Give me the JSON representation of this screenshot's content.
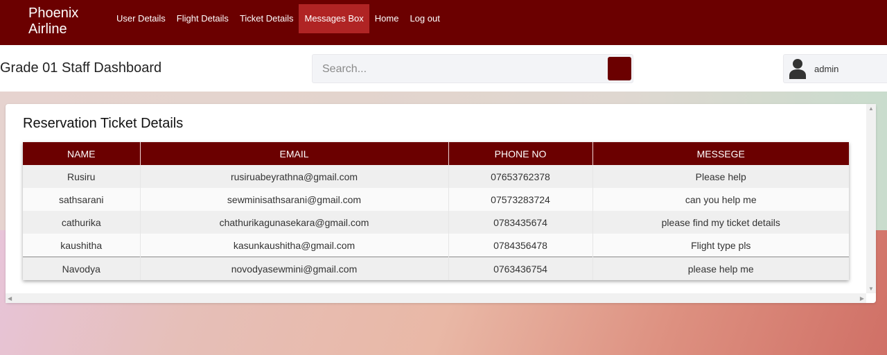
{
  "brand": {
    "line1": "Phoenix",
    "line2": "Airline"
  },
  "nav": {
    "items": [
      {
        "label": "User Details"
      },
      {
        "label": "Flight Details"
      },
      {
        "label": "Ticket Details"
      },
      {
        "label": "Messages Box",
        "active": true
      },
      {
        "label": "Home"
      },
      {
        "label": "Log out"
      }
    ]
  },
  "header": {
    "title": "Grade 01 Staff Dashboard",
    "search_placeholder": "Search...",
    "user": "admin"
  },
  "card": {
    "title": "Reservation Ticket Details",
    "columns": [
      "NAME",
      "EMAIL",
      "PHONE NO",
      "MESSEGE"
    ],
    "rows": [
      {
        "name": "Rusiru",
        "email": "rusiruabeyrathna@gmail.com",
        "phone": "07653762378",
        "message": "Please help"
      },
      {
        "name": "sathsarani",
        "email": "sewminisathsarani@gmail.com",
        "phone": "07573283724",
        "message": "can you help me"
      },
      {
        "name": "cathurika",
        "email": "chathurikagunasekara@gmail.com",
        "phone": "0783435674",
        "message": "please find my ticket details"
      },
      {
        "name": "kaushitha",
        "email": "kasunkaushitha@gmail.com",
        "phone": "0784356478",
        "message": "Flight type pls"
      },
      {
        "name": "Navodya",
        "email": "novodyasewmini@gmail.com",
        "phone": "0763436754",
        "message": "please help me"
      }
    ]
  },
  "colors": {
    "primary": "#6b0000",
    "active_nav": "#b02424"
  },
  "icons": {
    "user": "user-icon",
    "search": "search-icon"
  }
}
